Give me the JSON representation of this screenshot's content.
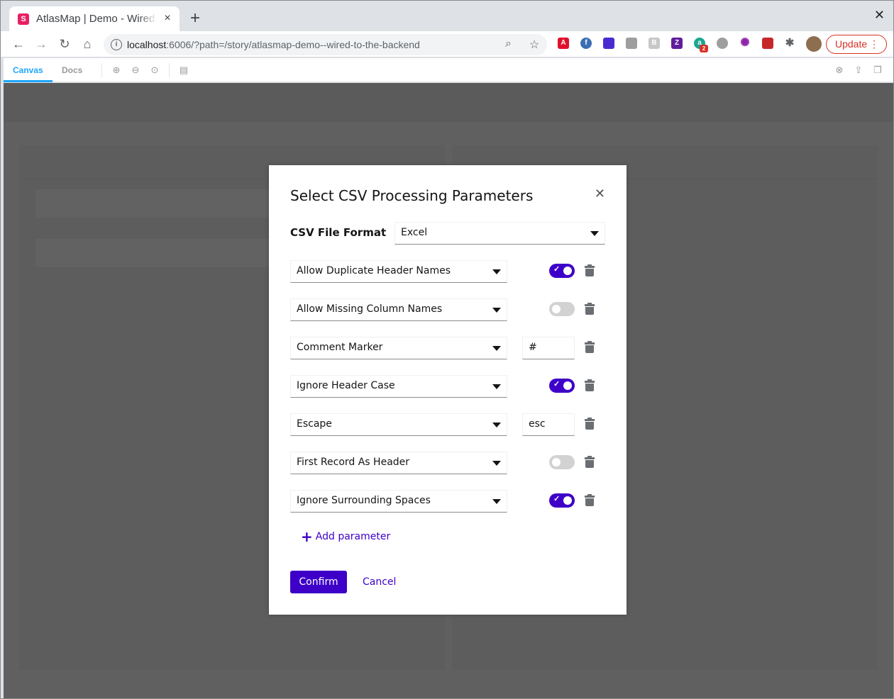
{
  "browser": {
    "tab_title": "AtlasMap | Demo - Wired to the backend",
    "tab_favicon": "S",
    "url_host": "localhost",
    "url_rest": ":6006/?path=/story/atlasmap-demo--wired-to-the-backend",
    "update_label": "Update",
    "extension_badge": "2"
  },
  "storybook": {
    "tabs": [
      "Canvas",
      "Docs"
    ]
  },
  "modal": {
    "title": "Select CSV Processing Parameters",
    "format_label": "CSV File Format",
    "format_value": "Excel",
    "parameters": [
      {
        "name": "Allow Duplicate Header Names",
        "kind": "toggle",
        "value": true
      },
      {
        "name": "Allow Missing Column Names",
        "kind": "toggle",
        "value": false
      },
      {
        "name": "Comment Marker",
        "kind": "text",
        "value": "#"
      },
      {
        "name": "Ignore Header Case",
        "kind": "toggle",
        "value": true
      },
      {
        "name": "Escape",
        "kind": "text",
        "value": "esc"
      },
      {
        "name": "First Record As Header",
        "kind": "toggle",
        "value": false
      },
      {
        "name": "Ignore Surrounding Spaces",
        "kind": "toggle",
        "value": true
      }
    ],
    "add_parameter_label": "Add parameter",
    "confirm_label": "Confirm",
    "cancel_label": "Cancel"
  },
  "colors": {
    "accent": "#3e00c8",
    "overlay": "#606060",
    "toggle_off": "#d2d2d2"
  }
}
